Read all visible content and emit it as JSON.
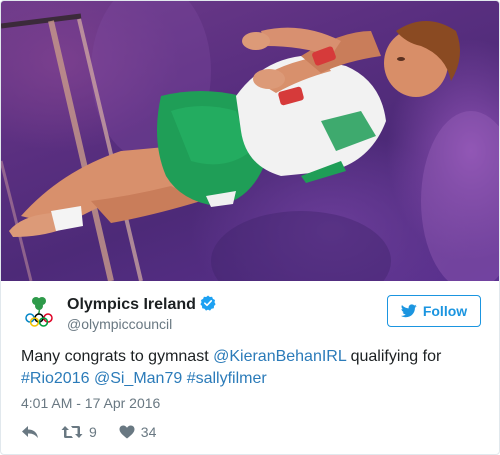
{
  "user": {
    "name": "Olympics Ireland",
    "handle": "@olympiccouncil",
    "verified": true
  },
  "follow_button": {
    "label": "Follow"
  },
  "tweet": {
    "text_before": "Many congrats to gymnast ",
    "mention1": "@KieranBehanIRL",
    "text_middle": " qualifying for ",
    "hashtag1": "#Rio2016",
    "mention2": "@Si_Man79",
    "hashtag2": "#sallyfilmer"
  },
  "timestamp": "4:01 AM - 17 Apr 2016",
  "actions": {
    "retweets": "9",
    "likes": "34"
  },
  "colors": {
    "link": "#2b7bb9",
    "follow_blue": "#1b95e0",
    "muted": "#697882",
    "photo_background": "#5a2f80",
    "kit_green": "#1f9e57"
  },
  "icons": {
    "logo": "olympic-rings-shamrock-logo",
    "verified": "verified-badge-icon",
    "follow": "twitter-bird-icon",
    "reply": "reply-icon",
    "retweet": "retweet-icon",
    "like": "heart-icon"
  }
}
